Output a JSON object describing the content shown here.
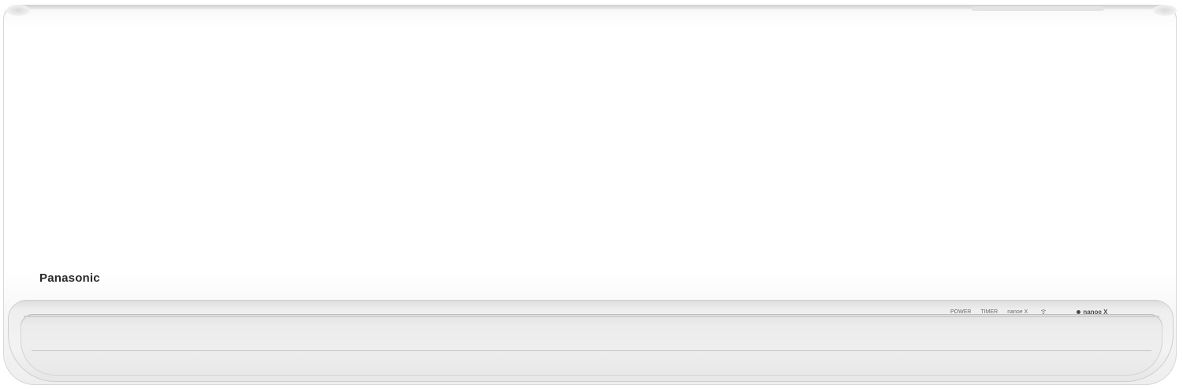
{
  "product": {
    "brand_logo": "Panasonic",
    "indicators": {
      "power": "POWER",
      "timer": "TIMER",
      "nanoe": "nanoe X",
      "wifi_icon": "wifi-icon",
      "brand_mark": "nanoe X"
    }
  },
  "colors": {
    "body": "#ffffff",
    "panel": "#ececec",
    "logo_text": "#2a2a2a",
    "indicator_text": "#6a6a6a"
  }
}
